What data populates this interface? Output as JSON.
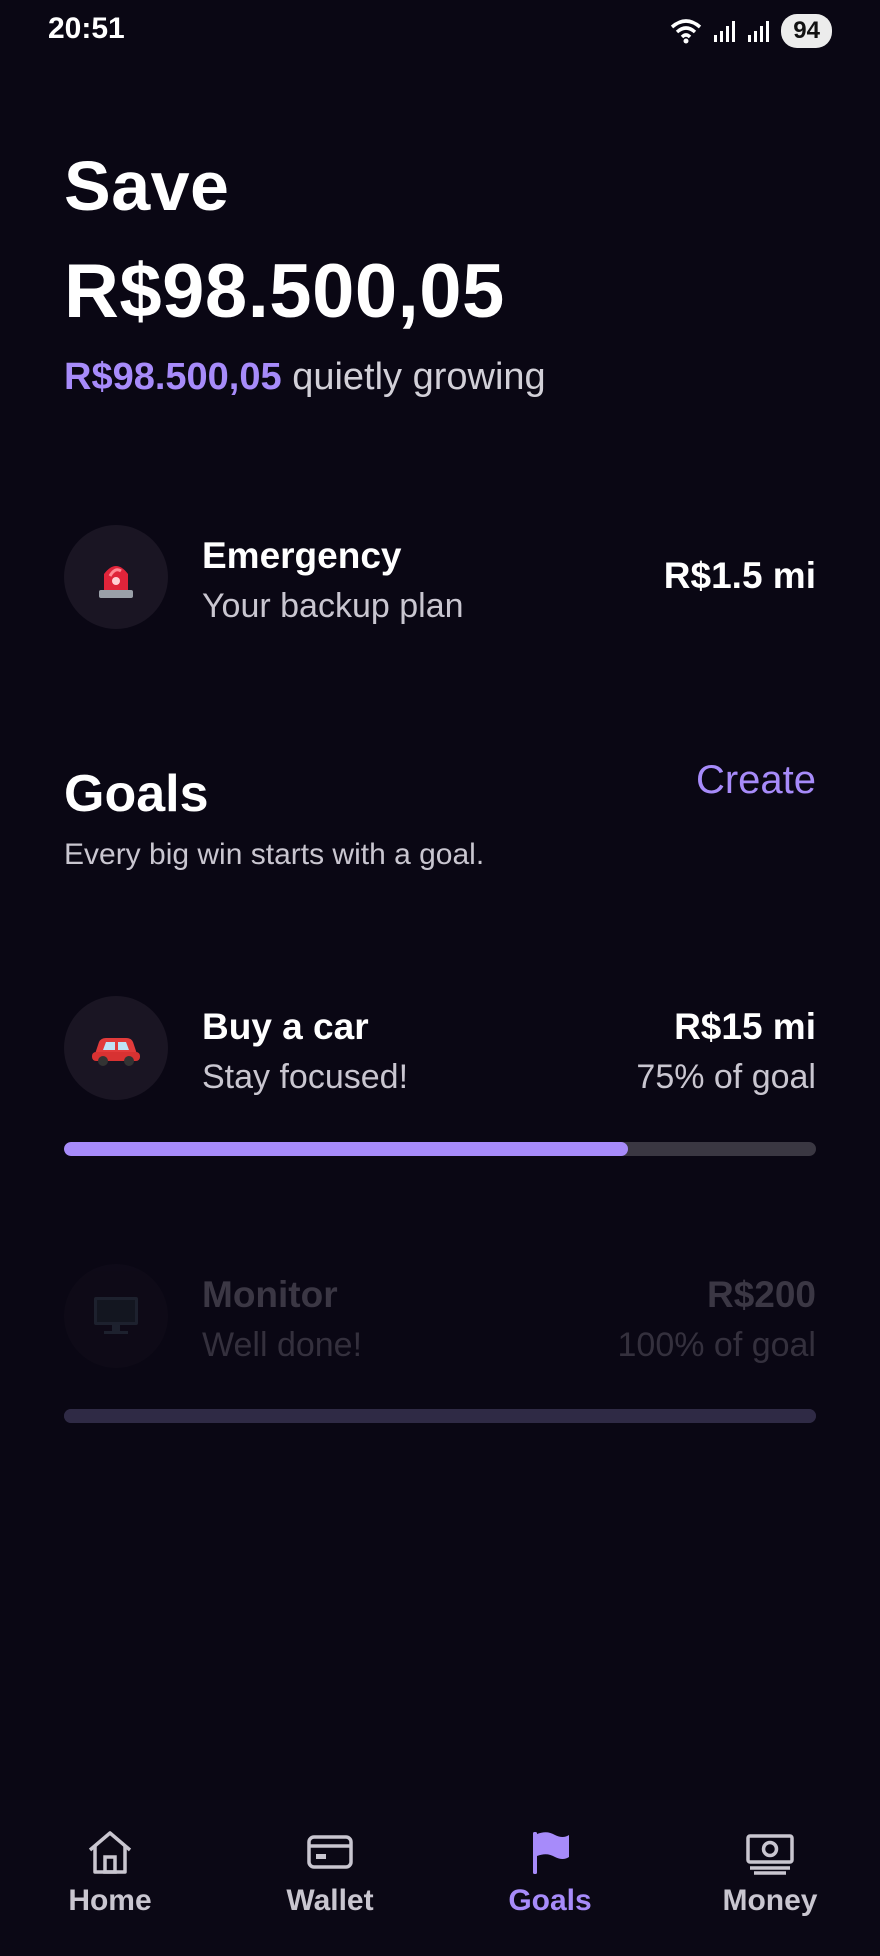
{
  "status_bar": {
    "time": "20:51",
    "battery": "94"
  },
  "header": {
    "title": "Save",
    "amount": "R$98.500,05",
    "sub_amount": "R$98.500,05",
    "sub_text": " quietly growing"
  },
  "emergency": {
    "icon": "police-light-icon",
    "title": "Emergency",
    "subtitle": "Your backup plan",
    "amount": "R$1.5 mi"
  },
  "goals_section": {
    "title": "Goals",
    "create_label": "Create",
    "subtitle": "Every big win starts with a goal."
  },
  "goals": [
    {
      "icon": "car-icon",
      "title": "Buy a car",
      "subtitle": "Stay focused!",
      "amount": "R$15 mi",
      "progress_label": "75% of goal",
      "progress": 0.75
    },
    {
      "icon": "monitor-icon",
      "title": "Monitor",
      "subtitle": "Well done!",
      "amount": "R$200",
      "progress_label": "100% of goal",
      "progress": 1.0
    }
  ],
  "bottom_nav": {
    "items": [
      {
        "label": "Home",
        "icon": "home-icon"
      },
      {
        "label": "Wallet",
        "icon": "wallet-icon"
      },
      {
        "label": "Goals",
        "icon": "flag-icon",
        "active": true
      },
      {
        "label": "Money",
        "icon": "money-icon"
      }
    ]
  },
  "colors": {
    "background": "#0a0714",
    "accent": "#a78bfa"
  }
}
